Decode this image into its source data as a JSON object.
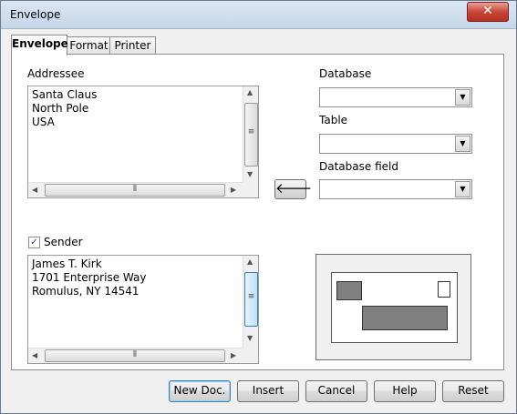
{
  "window": {
    "title": "Envelope",
    "close_glyph": "✕"
  },
  "tabs": [
    {
      "label": "Envelope"
    },
    {
      "label": "Format"
    },
    {
      "label": "Printer"
    }
  ],
  "addressee": {
    "label": "Addressee",
    "lines": [
      "Santa Claus",
      "North Pole",
      "USA"
    ]
  },
  "database": {
    "label": "Database",
    "value": ""
  },
  "table": {
    "label": "Table",
    "value": ""
  },
  "database_field": {
    "label": "Database field",
    "value": ""
  },
  "insert_arrow_glyph": "🡐",
  "sender": {
    "label": "Sender",
    "checked": true,
    "lines": [
      "James T. Kirk",
      "1701 Enterprise Way",
      "Romulus, NY 14541"
    ]
  },
  "scroll": {
    "up": "▲",
    "down": "▼",
    "left": "◀",
    "right": "▶",
    "grip": "⦀",
    "grip_v": "≡"
  },
  "buttons": {
    "new_doc": "New Doc.",
    "insert": "Insert",
    "cancel": "Cancel",
    "help": "Help",
    "reset": "Reset"
  },
  "colors": {
    "preview_fill": "#808080"
  }
}
